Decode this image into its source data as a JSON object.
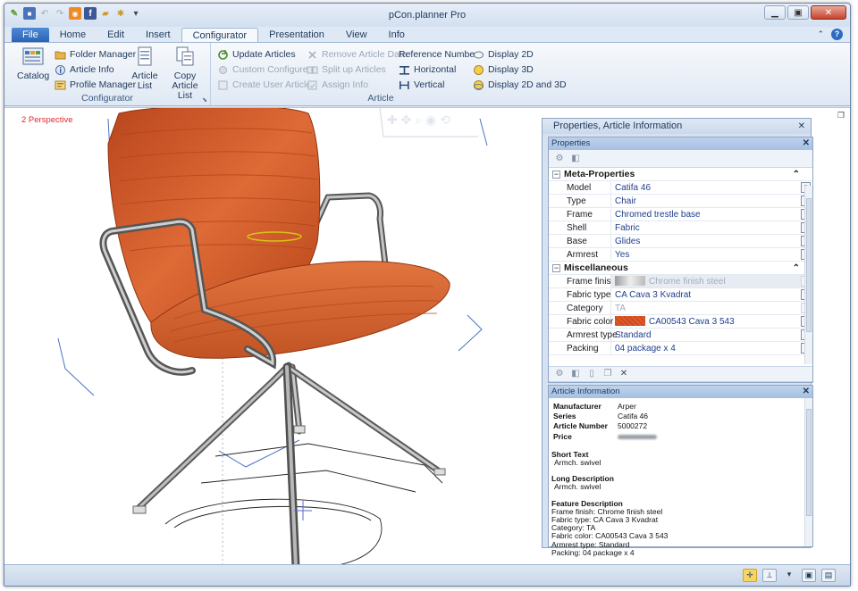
{
  "window": {
    "title": "pCon.planner Pro"
  },
  "tabs": [
    "File",
    "Home",
    "Edit",
    "Insert",
    "Configurator",
    "Presentation",
    "View",
    "Info"
  ],
  "active_tab": "Configurator",
  "ribbon": {
    "configurator_group": {
      "label": "Configurator",
      "catalog": "Catalog",
      "folder_manager": "Folder Manager",
      "article_info": "Article Info",
      "profile_manager": "Profile Manager",
      "article_list_1": "Article",
      "article_list_2": "List",
      "copy_list_1": "Copy",
      "copy_list_2": "Article List"
    },
    "article_group": {
      "label": "Article",
      "update_articles": "Update Articles",
      "custom_configure": "Custom Configure",
      "create_user_article": "Create User Article",
      "remove_article_data": "Remove Article Data",
      "split_up_articles": "Split up Articles",
      "assign_info": "Assign Info",
      "reference_number": "Reference Number",
      "horizontal": "Horizontal",
      "vertical": "Vertical",
      "display_2d": "Display 2D",
      "display_3d": "Display 3D",
      "display_2d_3d": "Display 2D and 3D"
    }
  },
  "viewport": {
    "label": "2 Perspective"
  },
  "panel": {
    "title": "Properties, Article Information",
    "properties_title": "Properties",
    "meta_section": "Meta-Properties",
    "meta_rows": [
      {
        "key": "Model",
        "value": "Catifa 46"
      },
      {
        "key": "Type",
        "value": "Chair"
      },
      {
        "key": "Frame",
        "value": "Chromed trestle base"
      },
      {
        "key": "Shell",
        "value": "Fabric"
      },
      {
        "key": "Base",
        "value": "Glides"
      },
      {
        "key": "Armrest",
        "value": "Yes"
      }
    ],
    "misc_section": "Miscellaneous",
    "misc_rows": [
      {
        "key": "Frame finish",
        "value": "Chrome finish steel"
      },
      {
        "key": "Fabric type",
        "value": "CA Cava 3 Kvadrat"
      },
      {
        "key": "Category",
        "value": "TA"
      },
      {
        "key": "Fabric color",
        "value": "CA00543 Cava 3 543"
      },
      {
        "key": "Armrest type",
        "value": "Standard"
      },
      {
        "key": "Packing",
        "value": "04 package x 4"
      }
    ],
    "article_info": {
      "title": "Article Information",
      "manufacturer_label": "Manufacturer",
      "manufacturer": "Arper",
      "series_label": "Series",
      "series": "Catifa 46",
      "article_number_label": "Article Number",
      "article_number": "5000272",
      "price_label": "Price",
      "short_text_label": "Short Text",
      "short_text": "Armch. swivel",
      "long_desc_label": "Long Description",
      "long_desc": "Armch. swivel",
      "feature_label": "Feature Description",
      "features": [
        "Frame finish: Chrome finish steel",
        "Fabric type: CA Cava 3 Kvadrat",
        "Category: TA",
        "Fabric color:  CA00543 Cava 3 543",
        "Armrest type: Standard",
        "Packing: 04 package x 4"
      ]
    }
  },
  "colors": {
    "accent": "#2a61b0",
    "shell": "#d4562a",
    "viewport_label": "#e8242a"
  }
}
